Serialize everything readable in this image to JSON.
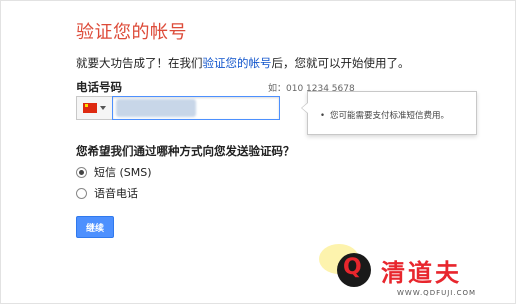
{
  "page": {
    "title": "验证您的帐号",
    "intro": {
      "before": "就要大功告成了！在我们",
      "link": "验证您的帐号",
      "after": "后，您就可以开始使用了。"
    }
  },
  "phone": {
    "label": "电话号码",
    "example": "如：010 1234 5678",
    "country_icon": "china-flag-icon",
    "value": ""
  },
  "tooltip": {
    "bullet": "•",
    "text": "您可能需要支付标准短信费用。"
  },
  "method": {
    "question": "您希望我们通过哪种方式向您发送验证码？",
    "options": [
      {
        "label": "短信 (SMS)",
        "checked": true
      },
      {
        "label": "语音电话",
        "checked": false
      }
    ]
  },
  "continue_label": "继续",
  "watermark": {
    "icon": "Q",
    "brand": "清道夫",
    "url": "WWW.QDFUJI.COM"
  },
  "colors": {
    "title": "#dd4b39",
    "link": "#1155cc",
    "button": "#4d90fe",
    "watermark": "#e8262d"
  }
}
